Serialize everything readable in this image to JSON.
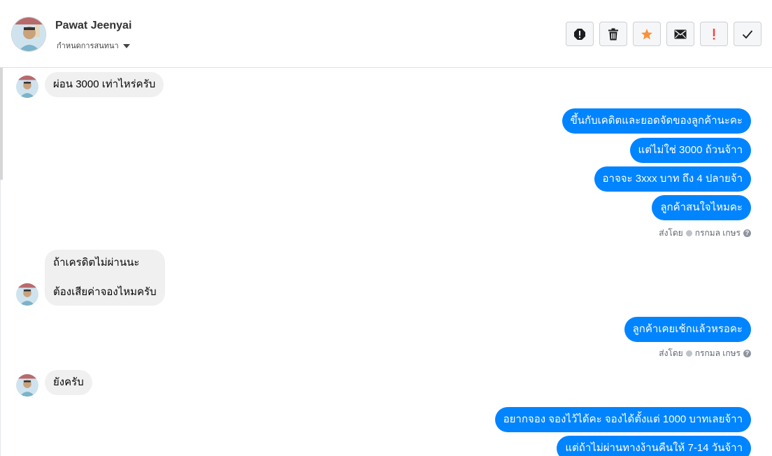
{
  "header": {
    "contact_name": "Pawat Jeenyai",
    "conversation_settings": "กำหนดการสนทนา"
  },
  "toolbar": {
    "buttons": [
      {
        "icon": "report-icon"
      },
      {
        "icon": "trash-icon"
      },
      {
        "icon": "star-icon"
      },
      {
        "icon": "mail-icon"
      },
      {
        "icon": "important-icon"
      },
      {
        "icon": "check-icon"
      }
    ]
  },
  "colors": {
    "outgoing": "#0084ff",
    "incoming": "#f0f0f0",
    "star": "#f7923b",
    "important": "#fa3e3e"
  },
  "messages": [
    {
      "dir": "in",
      "text": "ผ่อน 3000 เท่าไหร่ครับ"
    },
    {
      "dir": "out",
      "text": "ขึ้นกับเคดิตและยอดจัดของลูกค้านะคะ"
    },
    {
      "dir": "out",
      "text": "แต่ไม่ใช่ 3000 ถ้วนจ้าา"
    },
    {
      "dir": "out",
      "text": "อาจจะ 3xxx บาท ถึง 4 ปลายจ้า"
    },
    {
      "dir": "out",
      "text": "ลูกค้าสนใจไหมคะ"
    },
    {
      "dir": "in",
      "text": "ถ้าเครดิตไม่ผ่านนะ"
    },
    {
      "dir": "in",
      "text": "ต้องเสียค่าจองไหมครับ"
    },
    {
      "dir": "out",
      "text": "ลูกค้าเคยเช้กแล้วหรอคะ"
    },
    {
      "dir": "in",
      "text": "ยังครับ"
    },
    {
      "dir": "out",
      "text": "อยากจอง จองไว้ได้คะ จองได้ตั้งแต่ 1000 บาทเลยจ้าา"
    },
    {
      "dir": "out",
      "text": "แต่ถ้าไม่ผ่านทางง้านคืนให้ 7-14 วันจ้าา"
    }
  ],
  "sent_by": {
    "prefix": "ส่งโดย",
    "name": "กรกมล เกษร",
    "help": "?"
  }
}
